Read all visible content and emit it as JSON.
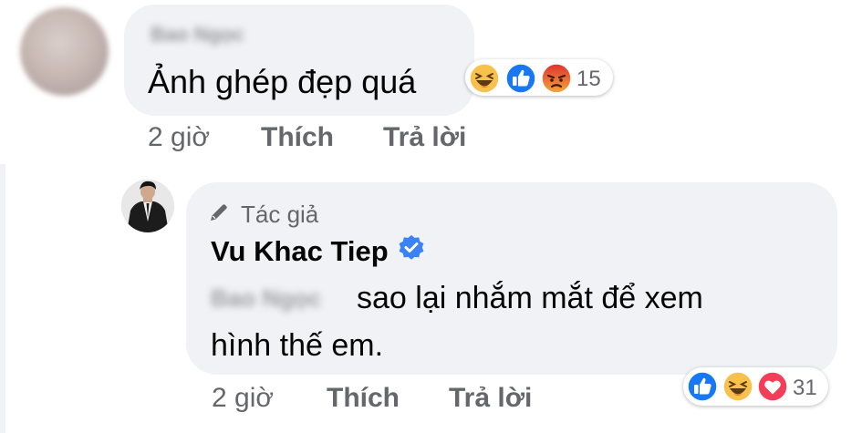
{
  "comments": [
    {
      "author": "Bao Ngọc",
      "text": "Ảnh ghép đẹp quá",
      "reactions": {
        "icons": [
          "haha-icon",
          "like-icon",
          "angry-icon"
        ],
        "count": "15"
      },
      "actions": {
        "time": "2 giờ",
        "like": "Thích",
        "reply": "Trả lời"
      }
    },
    {
      "badge": "Tác giả",
      "author": "Vu Khac Tiep",
      "verified": true,
      "mention": "Bao Ngọc",
      "text_line1": "sao lại nhắm mắt để xem",
      "text_line2": "hình thế em.",
      "reactions": {
        "icons": [
          "like-icon",
          "haha-icon",
          "love-icon"
        ],
        "count": "31"
      },
      "actions": {
        "time": "2 giờ",
        "like": "Thích",
        "reply": "Trả lời"
      }
    }
  ],
  "colors": {
    "bubble": "#f0f2f5",
    "secondary_text": "#65676b",
    "like_blue": "#1877f2",
    "haha_yellow": "#f7c14b",
    "love_red": "#f33e58",
    "angry_orange": "#e9710f",
    "verified_blue": "#3b82f6"
  }
}
